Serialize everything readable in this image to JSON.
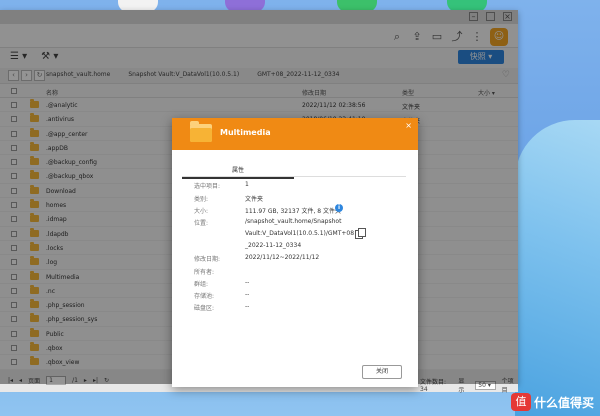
{
  "toolbar": {
    "snapshot_label": "快照"
  },
  "path": {
    "crumbs": [
      "snapshot_vault.home",
      "Snapshot Vault:V_DataVol1(10.0.5.1)",
      "GMT+08_2022-11-12_0334"
    ]
  },
  "table": {
    "headers": {
      "name": "名称",
      "date": "修改日期",
      "type": "类型",
      "size": "大小"
    },
    "rows": [
      {
        "name": ".@analytic",
        "date": "2022/11/12 02:38:56",
        "type": "文件夹"
      },
      {
        "name": ".antivirus",
        "date": "2018/06/10 23:41:10",
        "type": "文件夹"
      },
      {
        "name": ".@app_center",
        "date": "",
        "type": ""
      },
      {
        "name": ".appDB",
        "date": "",
        "type": ""
      },
      {
        "name": ".@backup_config",
        "date": "",
        "type": ""
      },
      {
        "name": ".@backup_qbox",
        "date": "",
        "type": ""
      },
      {
        "name": "Download",
        "date": "",
        "type": ""
      },
      {
        "name": "homes",
        "date": "",
        "type": ""
      },
      {
        "name": ".idmap",
        "date": "",
        "type": ""
      },
      {
        "name": ".ldapdb",
        "date": "",
        "type": ""
      },
      {
        "name": ".locks",
        "date": "",
        "type": ""
      },
      {
        "name": ".log",
        "date": "",
        "type": ""
      },
      {
        "name": "Multimedia",
        "date": "",
        "type": ""
      },
      {
        "name": ".nc",
        "date": "",
        "type": ""
      },
      {
        "name": ".php_session",
        "date": "",
        "type": ""
      },
      {
        "name": ".php_session_sys",
        "date": "",
        "type": ""
      },
      {
        "name": "Public",
        "date": "",
        "type": ""
      },
      {
        "name": ".qbox",
        "date": "",
        "type": ""
      },
      {
        "name": ".qbox_view",
        "date": "",
        "type": ""
      }
    ]
  },
  "status": {
    "page_label": "页面",
    "page_value": "1",
    "page_total": "/1",
    "count_label": "文件数目: 34",
    "per_page_label": "显示",
    "per_page_value": "50",
    "unit": "个项目"
  },
  "dialog": {
    "title": "Multimedia",
    "tab": "属性",
    "fields": [
      {
        "label": "选中项目:",
        "value": "1"
      },
      {
        "label": "类别:",
        "value": "文件夹"
      },
      {
        "label": "大小:",
        "value": "111.97 GB, 32137 文件, 8 文件夹"
      },
      {
        "label": "位置:",
        "value": "/snapshot_vault.home/Snapshot"
      },
      {
        "label": "",
        "value": "Vault:V_DataVol1(10.0.5.1)/GMT+08"
      },
      {
        "label": "",
        "value": "_2022-11-12_0334"
      },
      {
        "label": "修改日期:",
        "value": "2022/11/12~2022/11/12"
      },
      {
        "label": "所有者:",
        "value": ""
      },
      {
        "label": "群组:",
        "value": "--"
      },
      {
        "label": "存储池:",
        "value": "--"
      },
      {
        "label": "磁盘区:",
        "value": "--"
      }
    ],
    "close_label": "关闭"
  },
  "watermark": {
    "text": "什么值得买"
  }
}
